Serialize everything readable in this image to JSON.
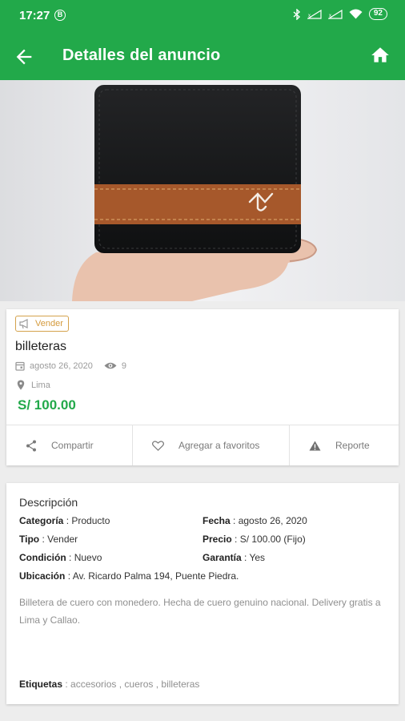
{
  "status_bar": {
    "time": "17:27",
    "battery": "92"
  },
  "app_bar": {
    "title": "Detalles del anuncio"
  },
  "listing": {
    "type_badge": "Vender",
    "name": "billeteras",
    "date": "agosto 26, 2020",
    "views": "9",
    "location": "Lima",
    "price": "S/ 100.00"
  },
  "actions": {
    "share": "Compartir",
    "favorite": "Agregar a favoritos",
    "report": "Reporte"
  },
  "description": {
    "title": "Descripción",
    "category_label": "Categoría",
    "category_value": "Producto",
    "type_label": "Tipo",
    "type_value": "Vender",
    "condition_label": "Condición",
    "condition_value": "Nuevo",
    "location_label": "Ubicación",
    "location_value": "Av. Ricardo Palma 194, Puente Piedra.",
    "date_label": "Fecha",
    "date_value": "agosto 26, 2020",
    "price_label": "Precio",
    "price_value": "S/ 100.00 (Fijo)",
    "warranty_label": "Garantía",
    "warranty_value": "Yes",
    "text": "Billetera de cuero con monedero. Hecha de cuero genuino nacional. Delivery gratis a Lima y Callao.",
    "tags_label": "Etiquetas",
    "tags_value": "accesorios , cueros , billeteras"
  },
  "colors": {
    "brand_green": "#22a94a",
    "badge_orange": "#d49a3c"
  }
}
